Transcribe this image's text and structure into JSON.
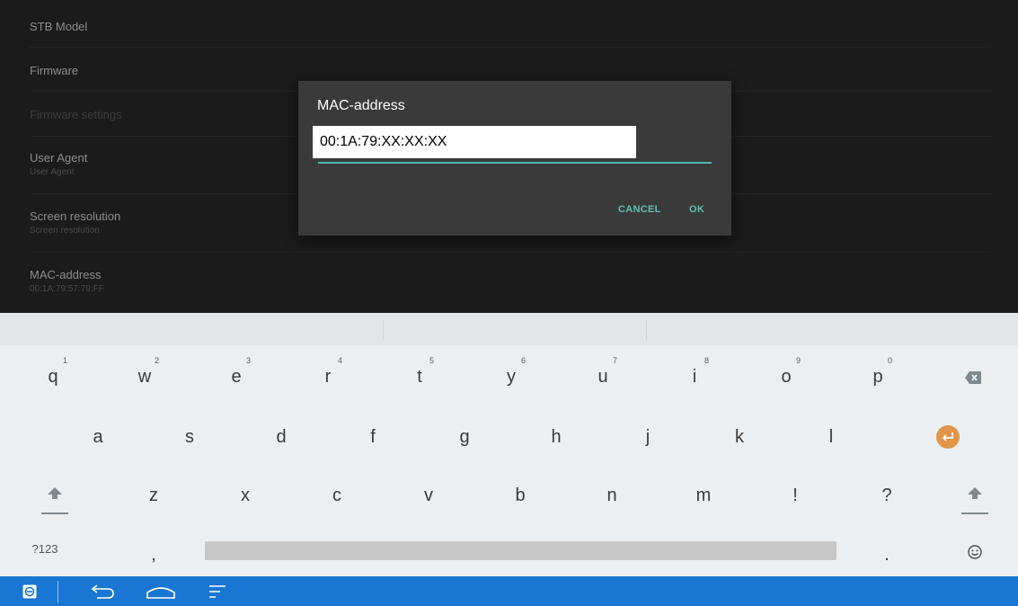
{
  "settings": {
    "items": [
      {
        "title": "STB Model",
        "subtitle": ""
      },
      {
        "title": "Firmware",
        "subtitle": ""
      },
      {
        "title": "Firmware settings",
        "subtitle": ""
      },
      {
        "title": "User Agent",
        "subtitle": "User Agent"
      },
      {
        "title": "Screen resolution",
        "subtitle": "Screen resolution"
      },
      {
        "title": "MAC-address",
        "subtitle": "00:1A:79:57:79:FF"
      }
    ]
  },
  "dialog": {
    "title": "MAC-address",
    "input_value": "00:1A:79:XX:XX:XX",
    "cancel_label": "CANCEL",
    "ok_label": "OK",
    "accent_color": "#4db6ac"
  },
  "keyboard": {
    "row1": [
      {
        "char": "q",
        "hint": "1"
      },
      {
        "char": "w",
        "hint": "2"
      },
      {
        "char": "e",
        "hint": "3"
      },
      {
        "char": "r",
        "hint": "4"
      },
      {
        "char": "t",
        "hint": "5"
      },
      {
        "char": "y",
        "hint": "6"
      },
      {
        "char": "u",
        "hint": "7"
      },
      {
        "char": "i",
        "hint": "8"
      },
      {
        "char": "o",
        "hint": "9"
      },
      {
        "char": "p",
        "hint": "0"
      }
    ],
    "row2": [
      "a",
      "s",
      "d",
      "f",
      "g",
      "h",
      "j",
      "k",
      "l"
    ],
    "row3": [
      "z",
      "x",
      "c",
      "v",
      "b",
      "n",
      "m",
      "!",
      "?"
    ],
    "symbols_label": "?123",
    "comma": ",",
    "period": ".",
    "icons": {
      "backspace": "backspace-icon",
      "enter": "enter-icon",
      "shift": "shift-icon",
      "emoji": "emoji-icon"
    },
    "enter_color": "#e0954a"
  },
  "navbar": {
    "color": "#1976d2",
    "icons": [
      "app-icon",
      "back-icon",
      "home-icon",
      "menu-icon"
    ]
  }
}
